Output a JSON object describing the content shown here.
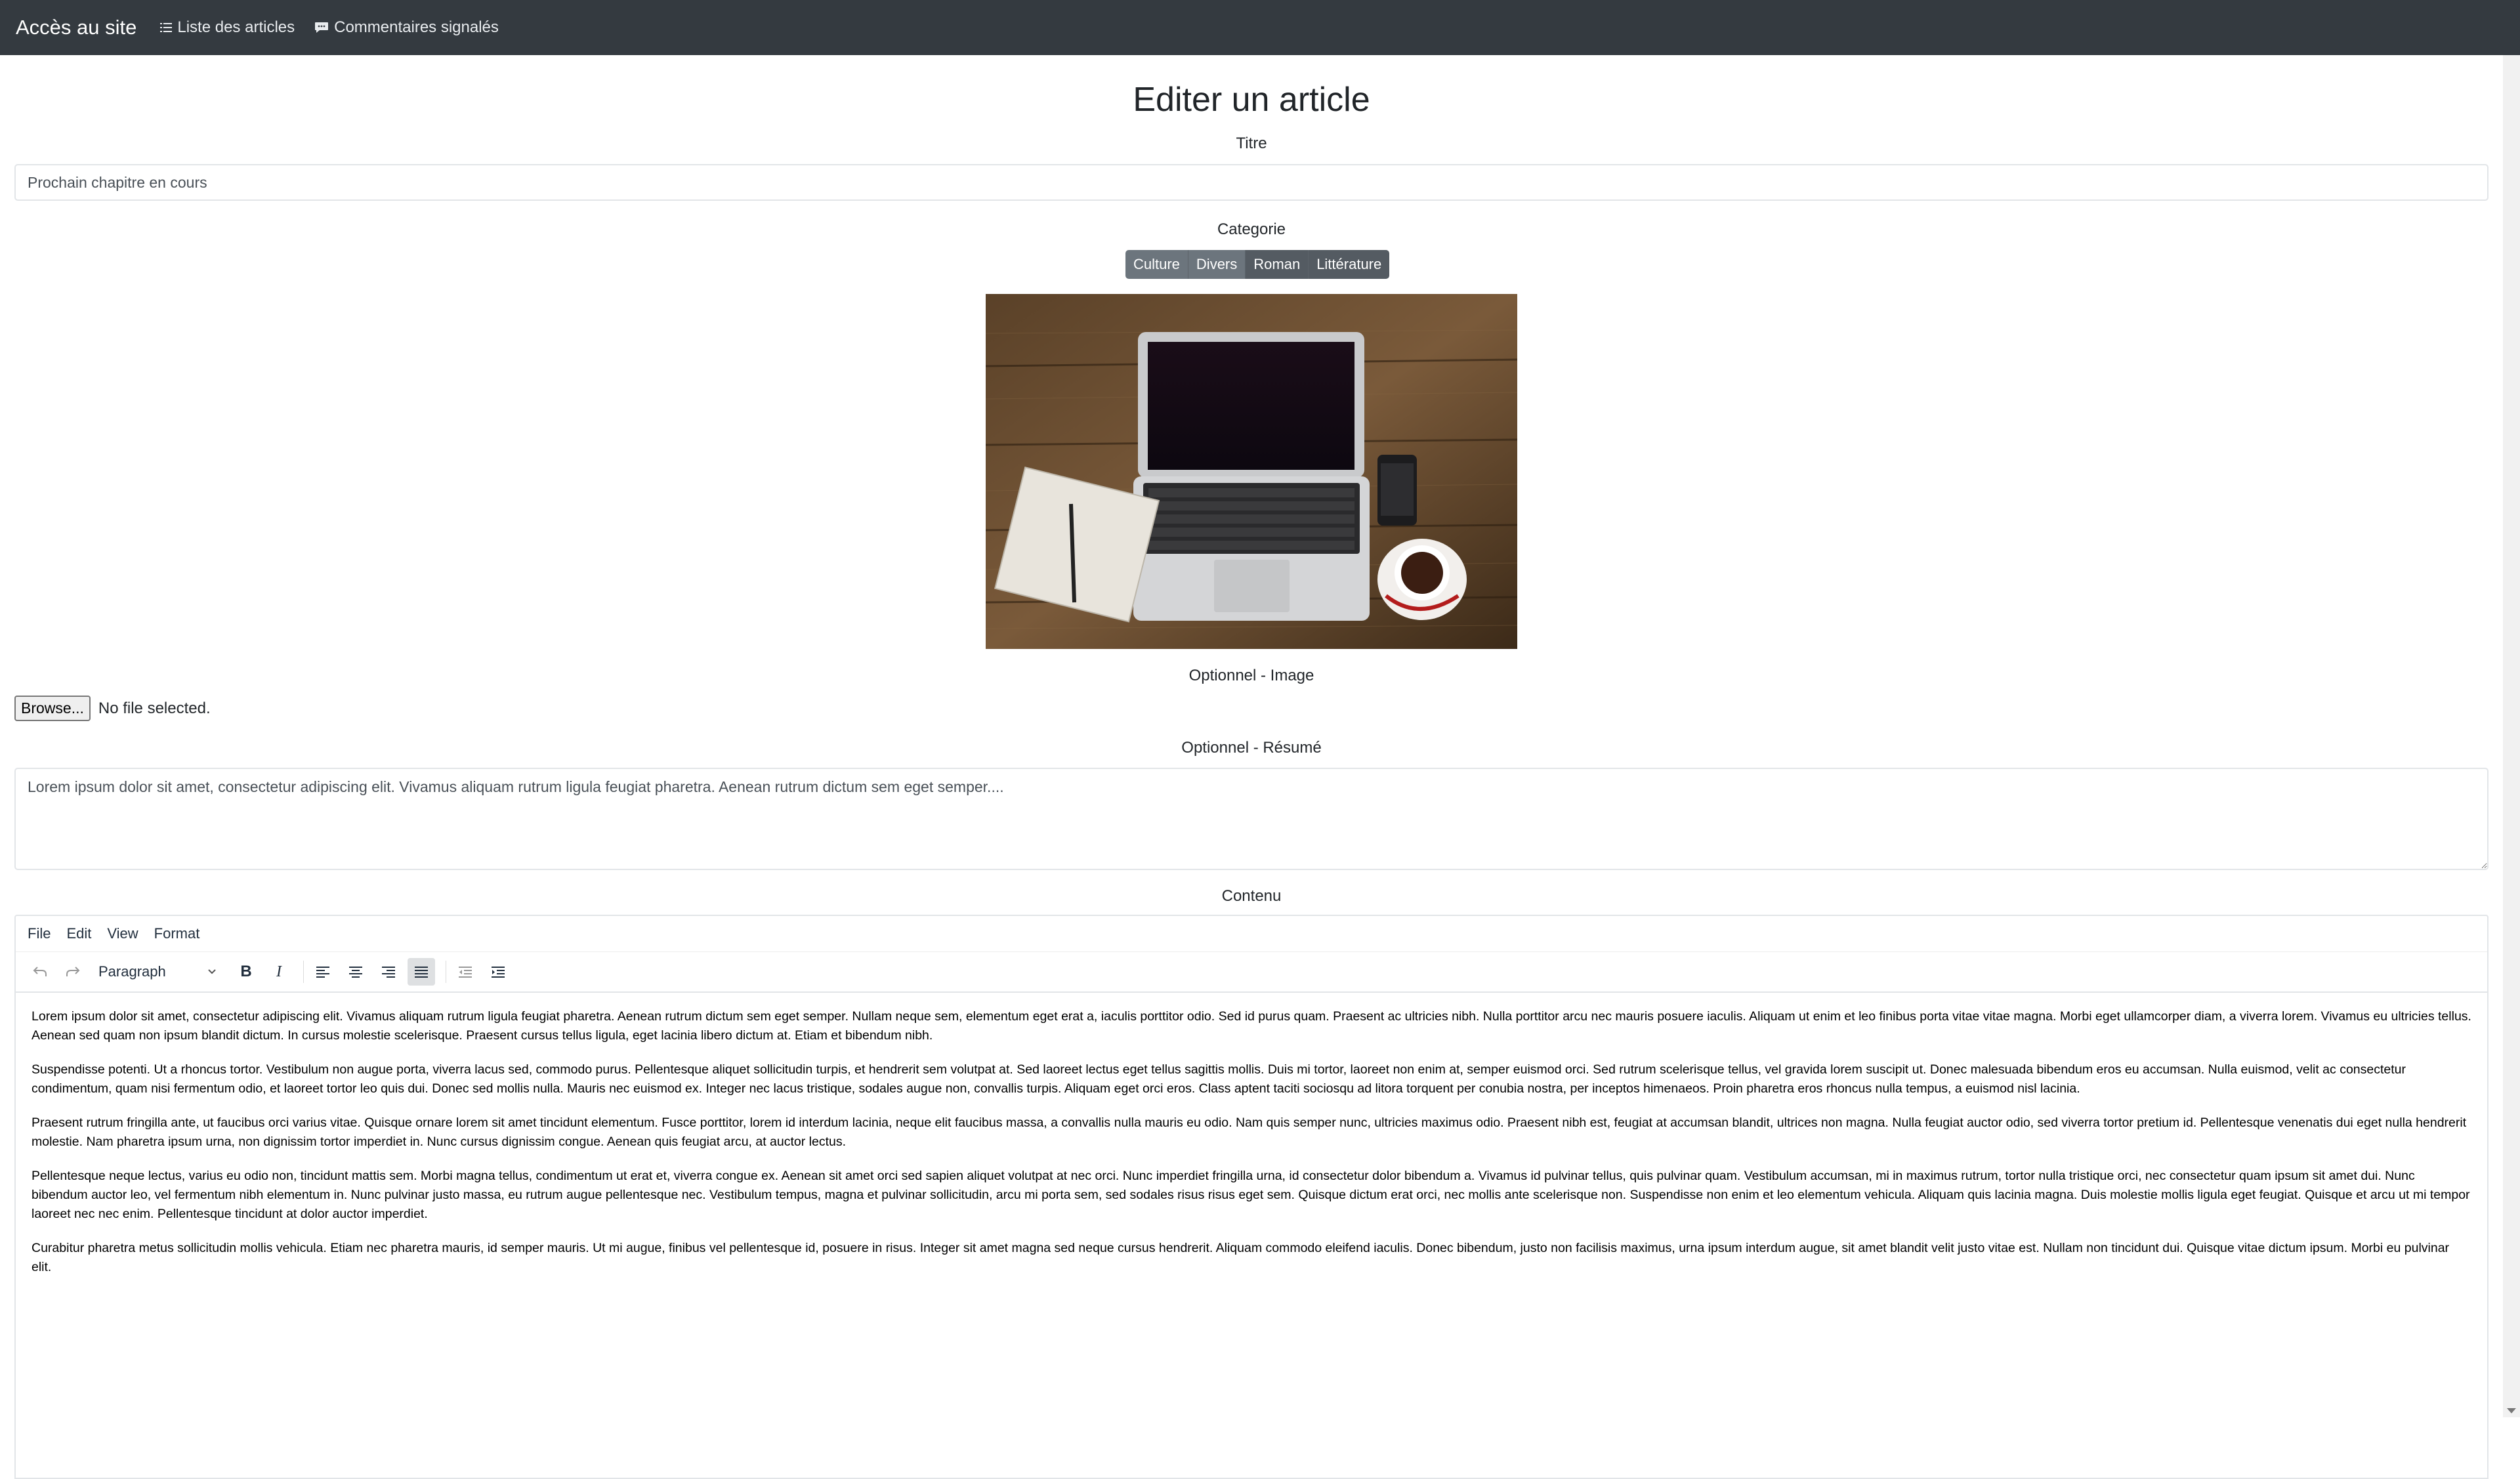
{
  "navbar": {
    "brand": "Accès au site",
    "links": [
      {
        "label": "Liste des articles",
        "icon": "list-icon"
      },
      {
        "label": "Commentaires signalés",
        "icon": "comment-icon"
      }
    ]
  },
  "page": {
    "title": "Editer un article"
  },
  "form": {
    "title_label": "Titre",
    "title_value": "Prochain chapitre en cours",
    "category_label": "Categorie",
    "categories": [
      {
        "label": "Culture",
        "active": false
      },
      {
        "label": "Divers",
        "active": false
      },
      {
        "label": "Roman",
        "active": true
      },
      {
        "label": "Littérature",
        "active": true
      }
    ],
    "image_alt": "laptop-on-desk-photo",
    "image_label": "Optionnel - Image",
    "browse_label": "Browse...",
    "file_status": "No file selected.",
    "summary_label": "Optionnel - Résumé",
    "summary_value": "Lorem ipsum dolor sit amet, consectetur adipiscing elit. Vivamus aliquam rutrum ligula feugiat pharetra. Aenean rutrum dictum sem eget semper....",
    "content_label": "Contenu"
  },
  "editor": {
    "menu": [
      "File",
      "Edit",
      "View",
      "Format"
    ],
    "block_format": "Paragraph",
    "paragraphs": [
      "Lorem ipsum dolor sit amet, consectetur adipiscing elit. Vivamus aliquam rutrum ligula feugiat pharetra. Aenean rutrum dictum sem eget semper. Nullam neque sem, elementum eget erat a, iaculis porttitor odio. Sed id purus quam. Praesent ac ultricies nibh. Nulla porttitor arcu nec mauris posuere iaculis. Aliquam ut enim et leo finibus porta vitae vitae magna. Morbi eget ullamcorper diam, a viverra lorem. Vivamus eu ultricies tellus. Aenean sed quam non ipsum blandit dictum. In cursus molestie scelerisque. Praesent cursus tellus ligula, eget lacinia libero dictum at. Etiam et bibendum nibh.",
      "Suspendisse potenti. Ut a rhoncus tortor. Vestibulum non augue porta, viverra lacus sed, commodo purus. Pellentesque aliquet sollicitudin turpis, et hendrerit sem volutpat at. Sed laoreet lectus eget tellus sagittis mollis. Duis mi tortor, laoreet non enim at, semper euismod orci. Sed rutrum scelerisque tellus, vel gravida lorem suscipit ut. Donec malesuada bibendum eros eu accumsan. Nulla euismod, velit ac consectetur condimentum, quam nisi fermentum odio, et laoreet tortor leo quis dui. Donec sed mollis nulla. Mauris nec euismod ex. Integer nec lacus tristique, sodales augue non, convallis turpis. Aliquam eget orci eros. Class aptent taciti sociosqu ad litora torquent per conubia nostra, per inceptos himenaeos. Proin pharetra eros rhoncus nulla tempus, a euismod nisl lacinia.",
      "Praesent rutrum fringilla ante, ut faucibus orci varius vitae. Quisque ornare lorem sit amet tincidunt elementum. Fusce porttitor, lorem id interdum lacinia, neque elit faucibus massa, a convallis nulla mauris eu odio. Nam quis semper nunc, ultricies maximus odio. Praesent nibh est, feugiat at accumsan blandit, ultrices non magna. Nulla feugiat auctor odio, sed viverra tortor pretium id. Pellentesque venenatis dui eget nulla hendrerit molestie. Nam pharetra ipsum urna, non dignissim tortor imperdiet in. Nunc cursus dignissim congue. Aenean quis feugiat arcu, at auctor lectus.",
      "Pellentesque neque lectus, varius eu odio non, tincidunt mattis sem. Morbi magna tellus, condimentum ut erat et, viverra congue ex. Aenean sit amet orci sed sapien aliquet volutpat at nec orci. Nunc imperdiet fringilla urna, id consectetur dolor bibendum a. Vivamus id pulvinar tellus, quis pulvinar quam. Vestibulum accumsan, mi in maximus rutrum, tortor nulla tristique orci, nec consectetur quam ipsum sit amet dui. Nunc bibendum auctor leo, vel fermentum nibh elementum in. Nunc pulvinar justo massa, eu rutrum augue pellentesque nec. Vestibulum tempus, magna et pulvinar sollicitudin, arcu mi porta sem, sed sodales risus risus eget sem. Quisque dictum erat orci, nec mollis ante scelerisque non. Suspendisse non enim et leo elementum vehicula. Aliquam quis lacinia magna. Duis molestie mollis ligula eget feugiat. Quisque et arcu ut mi tempor laoreet nec nec enim. Pellentesque tincidunt at dolor auctor imperdiet.",
      "Curabitur pharetra metus sollicitudin mollis vehicula. Etiam nec pharetra mauris, id semper mauris. Ut mi augue, finibus vel pellentesque id, posuere in risus. Integer sit amet magna sed neque cursus hendrerit. Aliquam commodo eleifend iaculis. Donec bibendum, justo non facilisis maximus, urna ipsum interdum augue, sit amet blandit velit justo vitae est. Nullam non tincidunt dui. Quisque vitae dictum ipsum. Morbi eu pulvinar elit."
    ]
  }
}
